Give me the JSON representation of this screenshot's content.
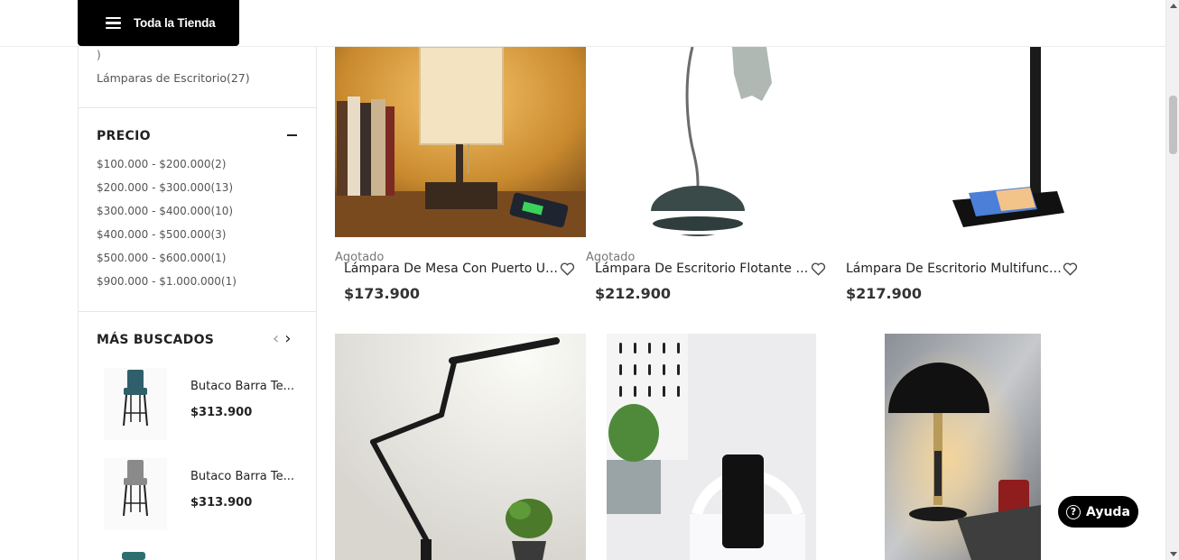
{
  "header": {
    "store_button_label": "Toda la Tienda"
  },
  "sidebar": {
    "category_tail": ")",
    "category_item": "Lámparas de Escritorio(27)",
    "price_title": "PRECIO",
    "price_ranges": [
      "$100.000 - $200.000(2)",
      "$200.000 - $300.000(13)",
      "$300.000 - $400.000(10)",
      "$400.000 - $500.000(3)",
      "$500.000 - $600.000(1)",
      "$900.000 - $1.000.000(1)"
    ],
    "most_searched_title": "MÁS BUSCADOS",
    "most_searched": [
      {
        "name": "Butaco Barra Te...",
        "price": "$313.900",
        "seat_color": "#2f5f6a"
      },
      {
        "name": "Butaco Barra Te...",
        "price": "$313.900",
        "seat_color": "#8a8a8a"
      }
    ]
  },
  "products": [
    {
      "status": "Agotado",
      "name": "Lámpara De Mesa Con Puerto US...",
      "price": "$173.900"
    },
    {
      "status": "Agotado",
      "name": "Lámpara De Escritorio Flotante A...",
      "price": "$212.900"
    },
    {
      "status": "",
      "name": "Lámpara De Escritorio Multifunci...",
      "price": "$217.900"
    }
  ],
  "help": {
    "label": "Ayuda"
  },
  "colors": {
    "brand_black": "#000000",
    "text": "#222222",
    "muted": "#777777"
  }
}
